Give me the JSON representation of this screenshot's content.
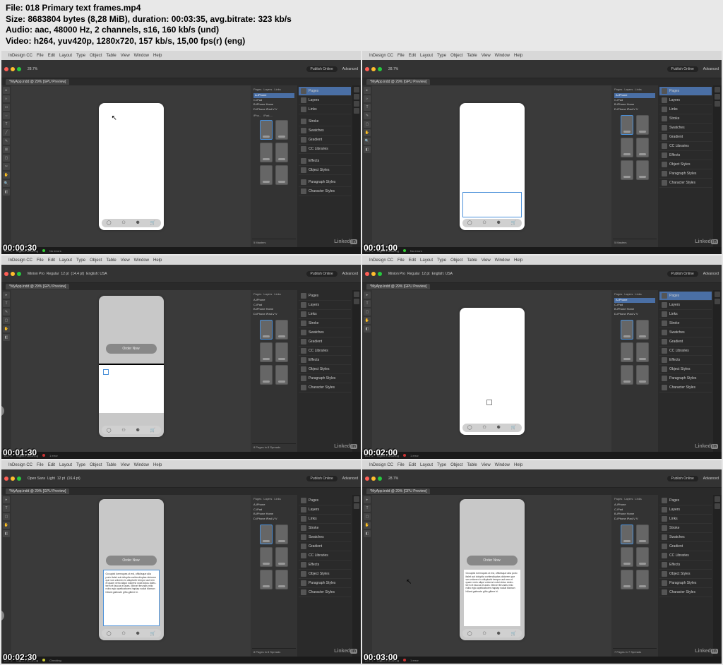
{
  "meta": {
    "line1": "File: 018 Primary text frames.mp4",
    "line2": "Size: 8683804 bytes (8,28 MiB), duration: 00:03:35, avg.bitrate: 323 kb/s",
    "line3": "Audio: aac, 48000 Hz, 2 channels, s16, 160 kb/s (und)",
    "line4": "Video: h264, yuv420p, 1280x720, 157 kb/s, 15,00 fps(r) (eng)"
  },
  "menubar": {
    "app": "InDesign CC",
    "items": [
      "File",
      "Edit",
      "Layout",
      "Type",
      "Object",
      "Table",
      "View",
      "Window",
      "Help"
    ]
  },
  "zoom": "28.7%",
  "publish_label": "Publish Online",
  "workspace_label": "Advanced",
  "doc_tab": "*MyApp.indd @ 29% [GPU Preview]",
  "panels_mid_tabs": [
    "Pages",
    "Layers",
    "Links"
  ],
  "page_list": [
    "A-iPhone",
    "C-iPad",
    "B-iPhone Home",
    "D-iPhone iPad-V V"
  ],
  "page_groups": [
    "iPho...",
    "iPad-..."
  ],
  "right_panels": {
    "top_tabs": [
      "Pages",
      "Layers",
      "Links"
    ],
    "items": [
      "Stroke",
      "Swatches",
      "Gradient",
      "CC Libraries",
      "Effects",
      "Object Styles",
      "Paragraph Styles",
      "Character Styles"
    ]
  },
  "status": {
    "dp": "Digital Publishing",
    "no_errors": "No errors",
    "one_error": "1 error",
    "checking": "Checking",
    "pages8": "8 Pages in 8 Spreads",
    "pages7": "7 Pages in 7 Spreads",
    "masters": "5 Masters"
  },
  "order_now": "Order Now",
  "lorem": "Occupist loremques ut est, officiisque alia porio italet aut doluptia coritendiuptas dolorem que vos volorero is ulluptortir tempor aut rem et quam verio aliqui volorest volut dolus dolec-term et faccus el ases. Minvel ferundis mito nobo egio apelicabores haptap nodat blamon hiliant gafeoste gifto-giltere hi.",
  "font_minion": "Minion Pro",
  "font_open_sans": "Open Sans",
  "font_weight_regular": "Regular",
  "font_weight_light": "Light",
  "font_size": "12 pt",
  "leading1": "(14.4 pt)",
  "leading2": "(16.4 pt)",
  "lang": "English: USA",
  "timestamps": [
    "00:00:30",
    "00:01:00",
    "00:01:30",
    "00:02:00",
    "00:02:30",
    "00:03:00"
  ],
  "linkedin": "Linked",
  "linkedin_in": "in"
}
